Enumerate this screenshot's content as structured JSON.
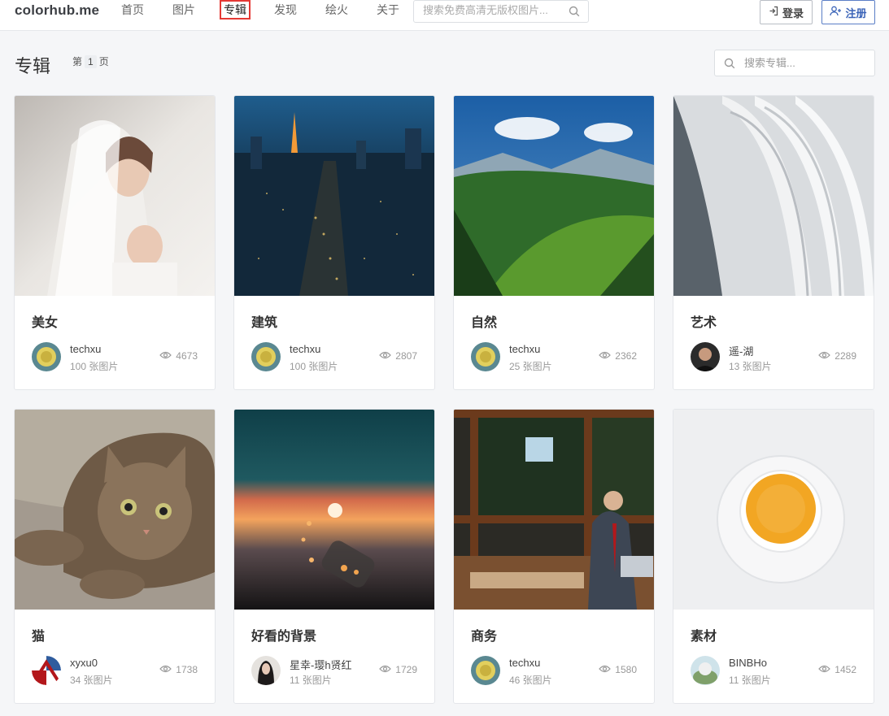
{
  "nav": {
    "brand": "colorhub.me",
    "items": [
      {
        "label": "首页"
      },
      {
        "label": "图片"
      },
      {
        "label": "专辑"
      },
      {
        "label": "发现"
      },
      {
        "label": "绘火"
      },
      {
        "label": "关于"
      }
    ],
    "search_placeholder": "搜索免费高清无版权图片...",
    "login_label": "登录",
    "signup_label": "注册"
  },
  "page": {
    "title": "专辑",
    "pager_prefix": "第",
    "pager_num": "1",
    "pager_suffix": "页",
    "search_placeholder": "搜索专辑..."
  },
  "albums": [
    {
      "title": "美女",
      "user": "techxu",
      "count": "100 张图片",
      "views": "4673"
    },
    {
      "title": "建筑",
      "user": "techxu",
      "count": "100 张图片",
      "views": "2807"
    },
    {
      "title": "自然",
      "user": "techxu",
      "count": "25 张图片",
      "views": "2362"
    },
    {
      "title": "艺术",
      "user": "遥-湖",
      "count": "13 张图片",
      "views": "2289"
    },
    {
      "title": "猫",
      "user": "xyxu0",
      "count": "34 张图片",
      "views": "1738"
    },
    {
      "title": "好看的背景",
      "user": "星幸-璎h贤红",
      "count": "11 张图片",
      "views": "1729"
    },
    {
      "title": "商务",
      "user": "techxu",
      "count": "46 张图片",
      "views": "1580"
    },
    {
      "title": "素材",
      "user": "BINBHo",
      "count": "11 张图片",
      "views": "1452"
    }
  ],
  "colors": {
    "accent_blue": "#3b64b8",
    "active_border": "#e53935"
  }
}
